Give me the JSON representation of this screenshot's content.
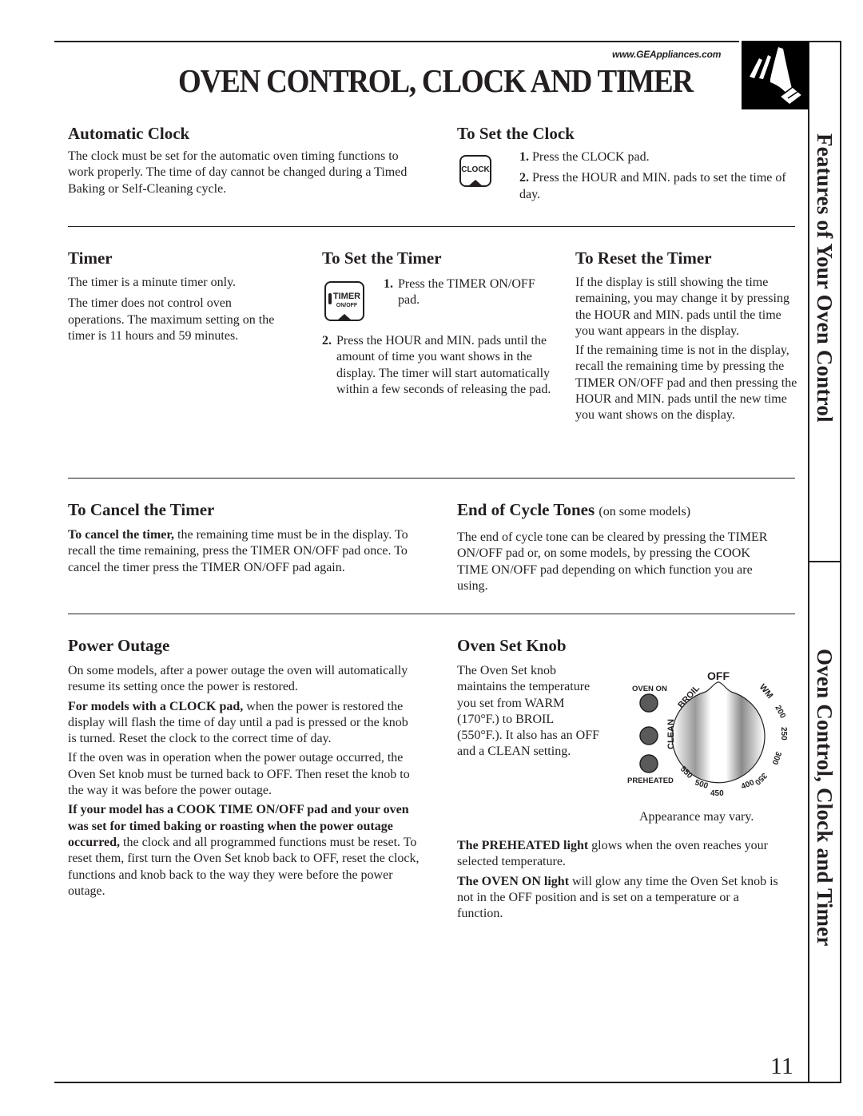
{
  "header": {
    "url": "www.GEAppliances.com",
    "title": "OVEN CONTROL, CLOCK AND TIMER",
    "logo_icon": "finger-pressing-pad-icon"
  },
  "side_tabs": {
    "upper": "Features of Your Oven Control",
    "lower": "Oven Control, Clock and Timer"
  },
  "sections": {
    "automatic_clock": {
      "heading": "Automatic Clock",
      "body": "The clock must be set for the automatic oven timing functions to work properly. The time of day cannot be changed during a Timed Baking or Self-Cleaning cycle."
    },
    "set_clock": {
      "heading": "To Set the Clock",
      "pad_label": "CLOCK",
      "steps": [
        {
          "num": "1.",
          "text": "Press the CLOCK pad."
        },
        {
          "num": "2.",
          "text": "Press the HOUR and MIN. pads to set the time of day."
        }
      ]
    },
    "timer": {
      "heading": "Timer",
      "paragraphs": [
        "The timer is a minute timer only.",
        "The timer does not control oven operations. The maximum setting on the timer is 11 hours and 59 minutes."
      ]
    },
    "set_timer": {
      "heading": "To Set the Timer",
      "pad_label_top": "TIMER",
      "pad_label_bottom": "ON/OFF",
      "steps": [
        {
          "num": "1.",
          "text": "Press the TIMER ON/OFF pad."
        },
        {
          "num": "2.",
          "text": "Press the HOUR and MIN. pads until the amount of time you want shows in the display. The timer will start automatically within a few seconds of releasing the pad."
        }
      ]
    },
    "reset_timer": {
      "heading": "To Reset the Timer",
      "paragraphs": [
        "If the display is still showing the time remaining, you may change it by pressing the HOUR and MIN. pads until the time you want appears in the display.",
        "If the remaining time is not in the display, recall the remaining time by pressing the TIMER ON/OFF pad and then pressing the HOUR and MIN. pads until the new time you want shows on the display."
      ]
    },
    "cancel_timer": {
      "heading": "To Cancel the Timer",
      "lead_bold": "To cancel the timer,",
      "body": " the remaining time must be in the display. To recall the time remaining, press the TIMER ON/OFF pad once. To cancel the timer press the TIMER ON/OFF pad again."
    },
    "end_of_cycle": {
      "heading": "End of Cycle Tones",
      "heading_note": "(on some models)",
      "body": "The end of cycle tone can be cleared by pressing the TIMER ON/OFF pad or, on some models, by pressing the COOK TIME ON/OFF pad depending on which function you are using."
    },
    "power_outage": {
      "heading": "Power Outage",
      "p1": "On some models, after a power outage the oven will automatically resume its setting once the power is restored.",
      "p2_bold": "For models with a CLOCK pad,",
      "p2": " when the power is restored the display will flash the time of day until a pad is pressed or the knob is turned. Reset the clock to the correct time of day.",
      "p3": "If the oven was in operation when the power outage occurred, the Oven Set knob must be turned back to OFF. Then reset the knob to the way it was before the power outage.",
      "p4_bold": "If your model has a COOK TIME ON/OFF pad and your oven was set for timed baking or roasting when the power outage occurred,",
      "p4": " the clock and all programmed functions must be reset. To reset them, first turn the Oven Set knob back to OFF, reset the clock, functions and knob back to the way they were before the power outage."
    },
    "oven_set_knob": {
      "heading": "Oven Set Knob",
      "body": "The Oven Set knob maintains the temperature you set from WARM (170°F.) to BROIL (550°F.). It also has an OFF and a CLEAN setting.",
      "caption": "Appearance may vary.",
      "lights": [
        "OVEN ON",
        "PREHEATED"
      ],
      "knob_labels": {
        "off": "OFF",
        "broil": "BROIL",
        "clean": "CLEAN",
        "wm": "WM",
        "temps": [
          "200",
          "250",
          "300",
          "350",
          "400",
          "450",
          "500",
          "550"
        ]
      },
      "preheated_bold": "The PREHEATED light",
      "preheated": " glows when the oven reaches your selected temperature.",
      "oven_on_bold": "The OVEN ON light",
      "oven_on": " will glow any time the Oven Set knob is not in the OFF position and is set on a temperature or a function."
    }
  },
  "footer": {
    "page_number": "11"
  }
}
